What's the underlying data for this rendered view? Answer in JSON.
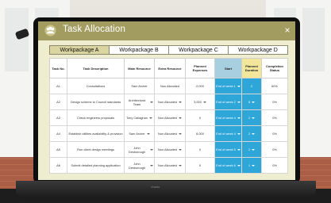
{
  "app": {
    "title": "Task Allocation",
    "close_icon": "×"
  },
  "tabs": [
    {
      "label": "Workpackage A",
      "active": true
    },
    {
      "label": "Workpackage B",
      "active": false
    },
    {
      "label": "Workpackage C",
      "active": false
    },
    {
      "label": "Workpackage D",
      "active": false
    }
  ],
  "columns": {
    "task_no": "Task No.",
    "task_desc": "Task Description",
    "main_resource": "Main Resource",
    "extra_resource": "Extra Resource",
    "planned_expenses": "Planned Expenses",
    "start": "Start",
    "planned_duration": "Planned Duration",
    "completion_status": "Completion Status"
  },
  "rows": [
    {
      "task_no": "A1",
      "desc": "Consultations",
      "main": "Sam Archer",
      "extra": "Non Allocated",
      "expenses": "2,000",
      "start": "End of week 1",
      "duration": "2",
      "status": "60%",
      "main_dd": false,
      "extra_dd": false,
      "exp_dd": false,
      "dur_dd": false
    },
    {
      "task_no": "A2",
      "desc": "Design scheme to Council standards",
      "main": "Architectural Team",
      "extra": "Non Allocated",
      "expenses": "3,000",
      "start": "End of week 2",
      "duration": "8",
      "status": "0%",
      "main_dd": true,
      "extra_dd": true,
      "exp_dd": true,
      "dur_dd": true
    },
    {
      "task_no": "A3",
      "desc": "Check engineers proposals",
      "main": "Tony Callaghan",
      "extra": "Non Allocated",
      "expenses": "0",
      "start": "End of week 4",
      "duration": "2",
      "status": "0%",
      "main_dd": true,
      "extra_dd": true,
      "exp_dd": false,
      "dur_dd": true
    },
    {
      "task_no": "A4",
      "desc": "Establish utilities availability & provision",
      "main": "Sam Archer",
      "extra": "Non Allocated",
      "expenses": "8,000",
      "start": "End of week 4",
      "duration": "2",
      "status": "0%",
      "main_dd": true,
      "extra_dd": true,
      "exp_dd": false,
      "dur_dd": true
    },
    {
      "task_no": "A5",
      "desc": "Run client design meetings",
      "main": "John Desborough",
      "extra": "Non Allocated",
      "expenses": "0",
      "start": "End of week 5",
      "duration": "2",
      "status": "0%",
      "main_dd": true,
      "extra_dd": true,
      "exp_dd": false,
      "dur_dd": true
    },
    {
      "task_no": "A6",
      "desc": "Submit detailed planning application",
      "main": "John Desborough",
      "extra": "Non Allocated",
      "expenses": "0",
      "start": "End of week 6",
      "duration": "1",
      "status": "0%",
      "main_dd": true,
      "extra_dd": true,
      "exp_dd": false,
      "dur_dd": true
    }
  ],
  "laptop": {
    "brand": "Vostro"
  },
  "colors": {
    "titlebar": "#a29c60",
    "panel": "#efedcf",
    "start_cell": "#2ea6d8",
    "header_blue": "#a7cfe0",
    "header_yellow": "#f1e69a"
  }
}
